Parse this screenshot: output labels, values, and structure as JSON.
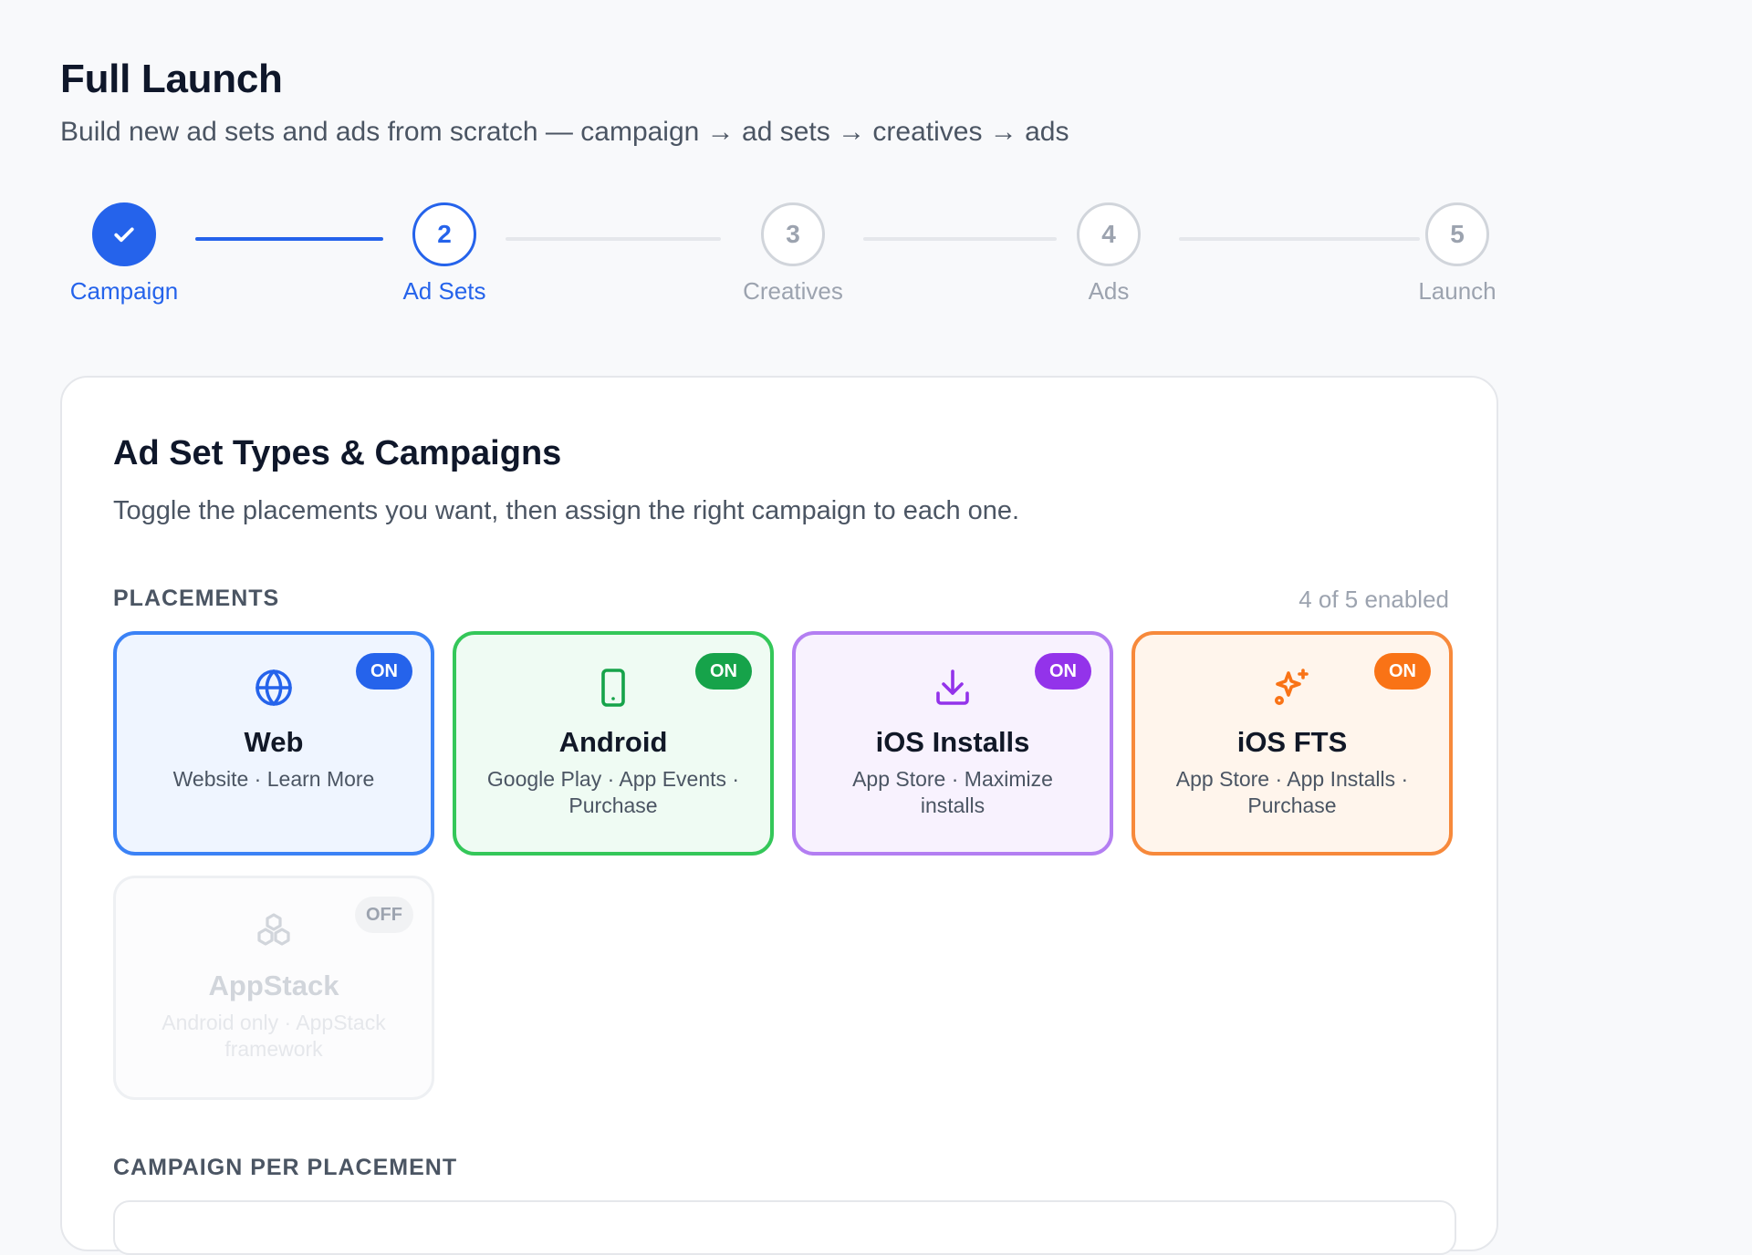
{
  "header": {
    "title": "Full Launch",
    "subtitle": "Build new ad sets and ads from scratch — campaign → ad sets → creatives → ads"
  },
  "stepper": {
    "steps": [
      {
        "number": "✓",
        "label": "Campaign",
        "state": "done"
      },
      {
        "number": "2",
        "label": "Ad Sets",
        "state": "active"
      },
      {
        "number": "3",
        "label": "Creatives",
        "state": "pending"
      },
      {
        "number": "4",
        "label": "Ads",
        "state": "pending"
      },
      {
        "number": "5",
        "label": "Launch",
        "state": "pending"
      }
    ]
  },
  "card": {
    "title": "Ad Set Types & Campaigns",
    "subtitle": "Toggle the placements you want, then assign the right campaign to each one.",
    "placements_label": "PLACEMENTS",
    "enabled_count": "4 of 5 enabled",
    "campaign_label": "CAMPAIGN PER PLACEMENT"
  },
  "placements": [
    {
      "name": "Web",
      "desc": "Website · Learn More",
      "status": "ON",
      "icon": "globe-icon",
      "color": "#2563eb",
      "bg": "#eff5ff",
      "border": "#3b82f6"
    },
    {
      "name": "Android",
      "desc": "Google Play · App Events · Purchase",
      "status": "ON",
      "icon": "smartphone-icon",
      "color": "#16a34a",
      "bg": "#effbf3",
      "border": "#34c759"
    },
    {
      "name": "iOS Installs",
      "desc": "App Store · Maximize installs",
      "status": "ON",
      "icon": "download-icon",
      "color": "#9333ea",
      "bg": "#f8f2fe",
      "border": "#b37ef2"
    },
    {
      "name": "iOS FTS",
      "desc": "App Store · App Installs · Purchase",
      "status": "ON",
      "icon": "sparkles-icon",
      "color": "#f97316",
      "bg": "#fff5ec",
      "border": "#f7893b"
    },
    {
      "name": "AppStack",
      "desc": "Android only · AppStack framework",
      "status": "OFF",
      "icon": "boxes-icon",
      "color": "#d1d5db",
      "bg": "#fcfcfd",
      "border": "#eef0f3"
    }
  ]
}
